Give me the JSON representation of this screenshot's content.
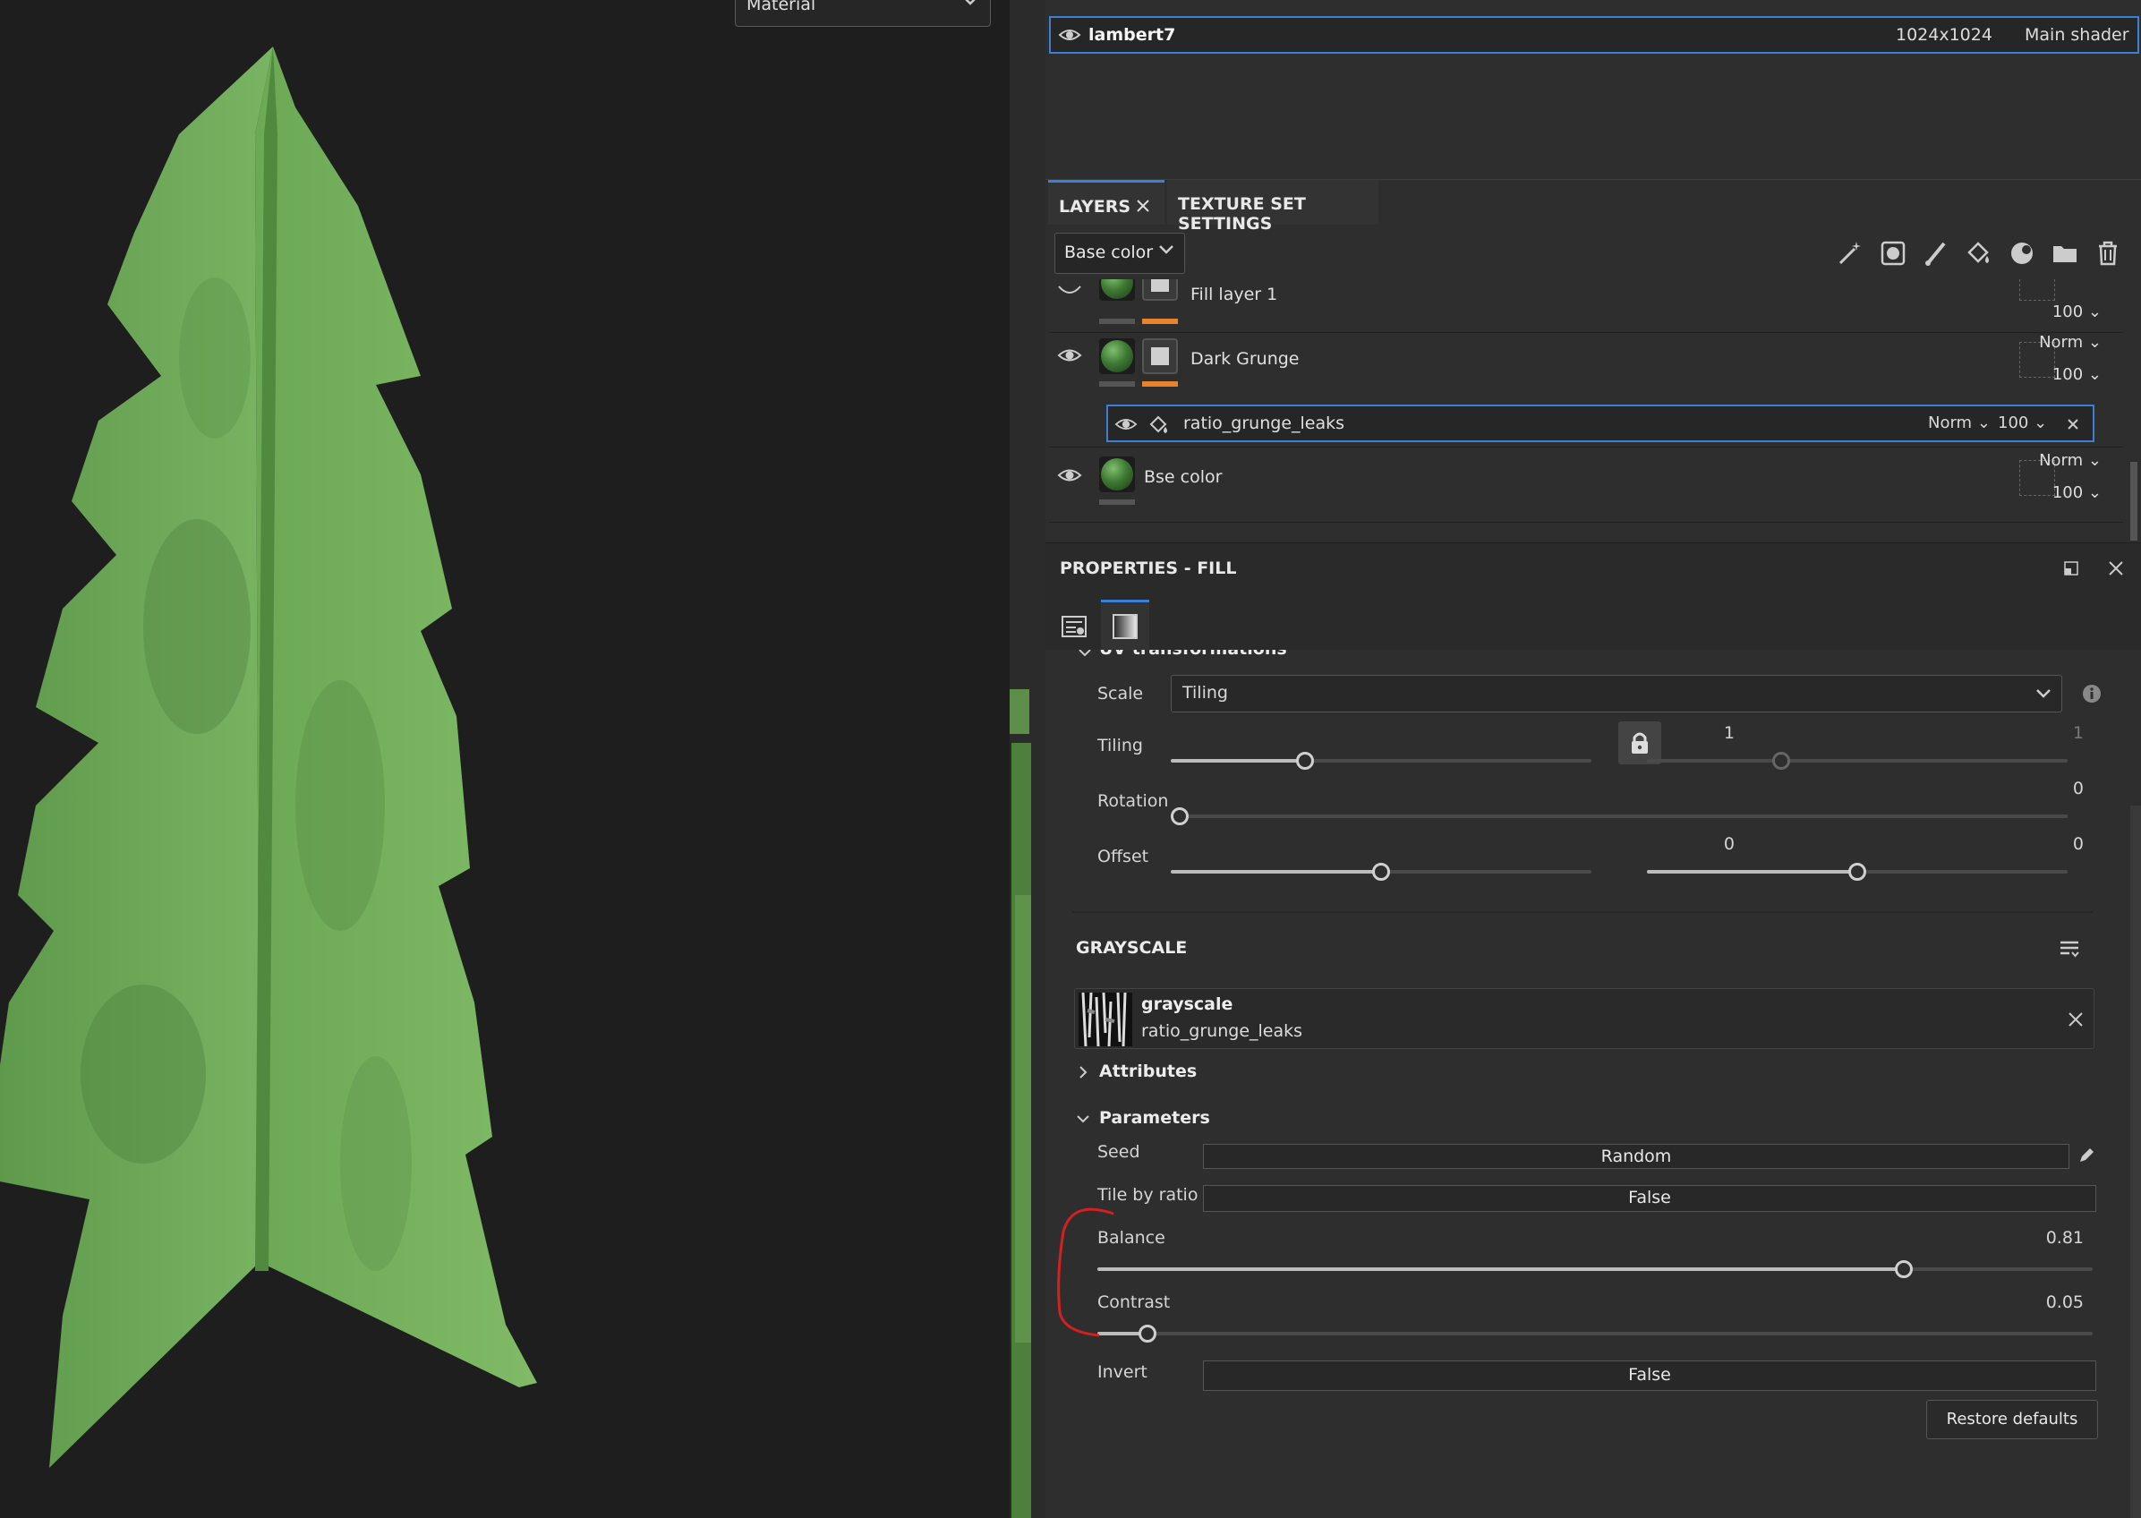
{
  "viewport": {
    "material_dropdown": "Material"
  },
  "texture_set": {
    "name": "lambert7",
    "resolution": "1024x1024",
    "shader": "Main shader"
  },
  "tabs": {
    "layers": "LAYERS",
    "texture_set_settings": "TEXTURE SET SETTINGS"
  },
  "layers_toolbar": {
    "channel": "Base color"
  },
  "layers": {
    "fill_layer": {
      "name": "Fill layer 1",
      "opacity": "100"
    },
    "dark_grunge": {
      "name": "Dark Grunge",
      "blend": "Norm",
      "opacity": "100"
    },
    "effect": {
      "name": "ratio_grunge_leaks",
      "blend": "Norm",
      "opacity": "100"
    },
    "base": {
      "name": "Bse color",
      "blend": "Norm",
      "opacity": "100"
    }
  },
  "properties": {
    "title": "PROPERTIES - FILL",
    "uv": {
      "section": "UV transformations",
      "scale_label": "Scale",
      "scale_value": "Tiling",
      "tiling_label": "Tiling",
      "tiling_a": "1",
      "tiling_b": "1",
      "rotation_label": "Rotation",
      "rotation_value": "0",
      "offset_label": "Offset",
      "offset_a": "0",
      "offset_b": "0"
    },
    "grayscale": {
      "section": "GRAYSCALE",
      "resource_title": "grayscale",
      "resource_name": "ratio_grunge_leaks",
      "attributes": "Attributes",
      "parameters": "Parameters",
      "seed_label": "Seed",
      "seed_value": "Random",
      "tile_label": "Tile by ratio",
      "tile_value": "False",
      "balance_label": "Balance",
      "balance_value": "0.81",
      "contrast_label": "Contrast",
      "contrast_value": "0.05",
      "invert_label": "Invert",
      "invert_value": "False",
      "restore": "Restore defaults"
    }
  },
  "slider_levels": {
    "tiling_a": 0.32,
    "tiling_b": 0.32,
    "rotation": 0.0,
    "offset_a": 0.5,
    "offset_b": 0.5,
    "balance": 0.81,
    "contrast": 0.05
  },
  "colors": {
    "accent": "#3b7fd6",
    "mask_marker": "#e8832b",
    "annotation": "#d42020",
    "foliage": "#6fa85a"
  }
}
